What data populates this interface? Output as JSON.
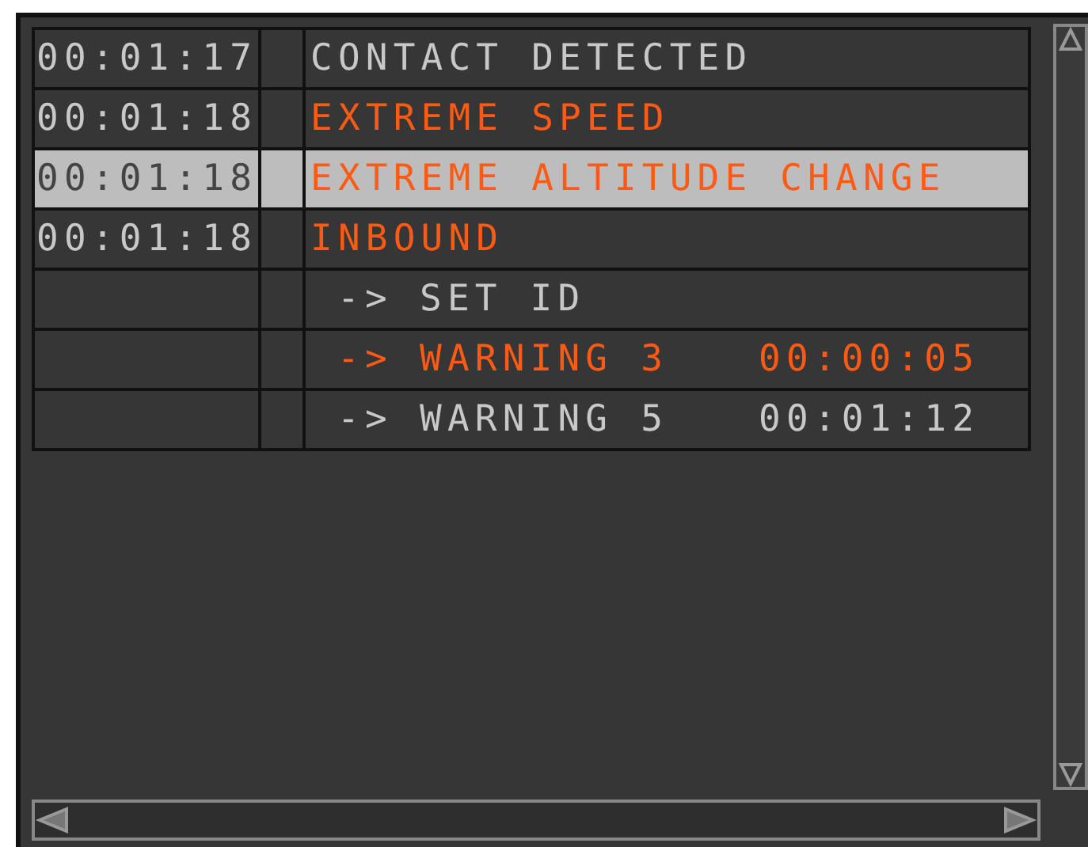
{
  "rows": [
    {
      "kind": "event",
      "time": "00:01:17",
      "message": "CONTACT DETECTED",
      "alert": false,
      "selected": false
    },
    {
      "kind": "event",
      "time": "00:01:18",
      "message": "EXTREME SPEED",
      "alert": true,
      "selected": false
    },
    {
      "kind": "event",
      "time": "00:01:18",
      "message": "EXTREME ALTITUDE CHANGE",
      "alert": true,
      "selected": true
    },
    {
      "kind": "event",
      "time": "00:01:18",
      "message": "INBOUND",
      "alert": true,
      "selected": false
    },
    {
      "kind": "sub",
      "arrow": "->",
      "message": "SET ID",
      "alert": false,
      "selected": false
    },
    {
      "kind": "sub",
      "arrow": "->",
      "message": "WARNING 3",
      "timer": "00:00:05",
      "alert": true,
      "selected": false
    },
    {
      "kind": "sub",
      "arrow": "->",
      "message": "WARNING 5",
      "timer": "00:01:12",
      "alert": false,
      "selected": false
    }
  ]
}
